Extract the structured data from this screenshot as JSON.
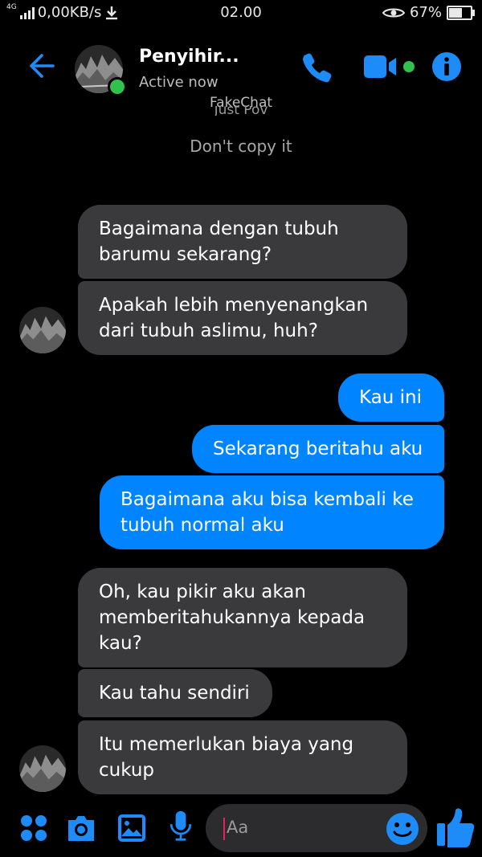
{
  "status_bar": {
    "network_type": "4G",
    "speed": "0,00KB/s",
    "time": "02.00",
    "battery": "67%",
    "battery_level": 0.67
  },
  "header": {
    "contact_name": "Penyihir...",
    "presence": "Active now",
    "watermark": "FakeChat",
    "subtitle_cropped": "Just Pov",
    "notice": "Don't copy it"
  },
  "messages": [
    {
      "direction": "received",
      "text": "Bagaimana dengan tubuh barumu sekarang?"
    },
    {
      "direction": "received",
      "text": "Apakah lebih menyenangkan dari tubuh aslimu, huh?"
    },
    {
      "direction": "sent",
      "text": "Kau ini"
    },
    {
      "direction": "sent",
      "text": "Sekarang beritahu aku"
    },
    {
      "direction": "sent",
      "text": "Bagaimana aku bisa kembali ke tubuh normal aku"
    },
    {
      "direction": "received",
      "text": "Oh, kau pikir aku akan memberitahukannya kepada kau?"
    },
    {
      "direction": "received",
      "text": "Kau tahu sendiri"
    },
    {
      "direction": "received",
      "text": "Itu memerlukan biaya yang cukup"
    }
  ],
  "composer": {
    "placeholder": "Aa"
  },
  "icons": {
    "back": "arrow-left-icon",
    "call": "phone-icon",
    "video": "video-camera-icon",
    "info": "info-icon",
    "menu": "four-dots-icon",
    "camera": "camera-icon",
    "gallery": "image-icon",
    "mic": "microphone-icon",
    "emoji": "smiley-icon",
    "like": "thumbs-up-icon"
  },
  "colors": {
    "accent": "#0084ff",
    "received_bubble": "#3a3a3c",
    "online": "#31c24d",
    "background": "#000000"
  }
}
